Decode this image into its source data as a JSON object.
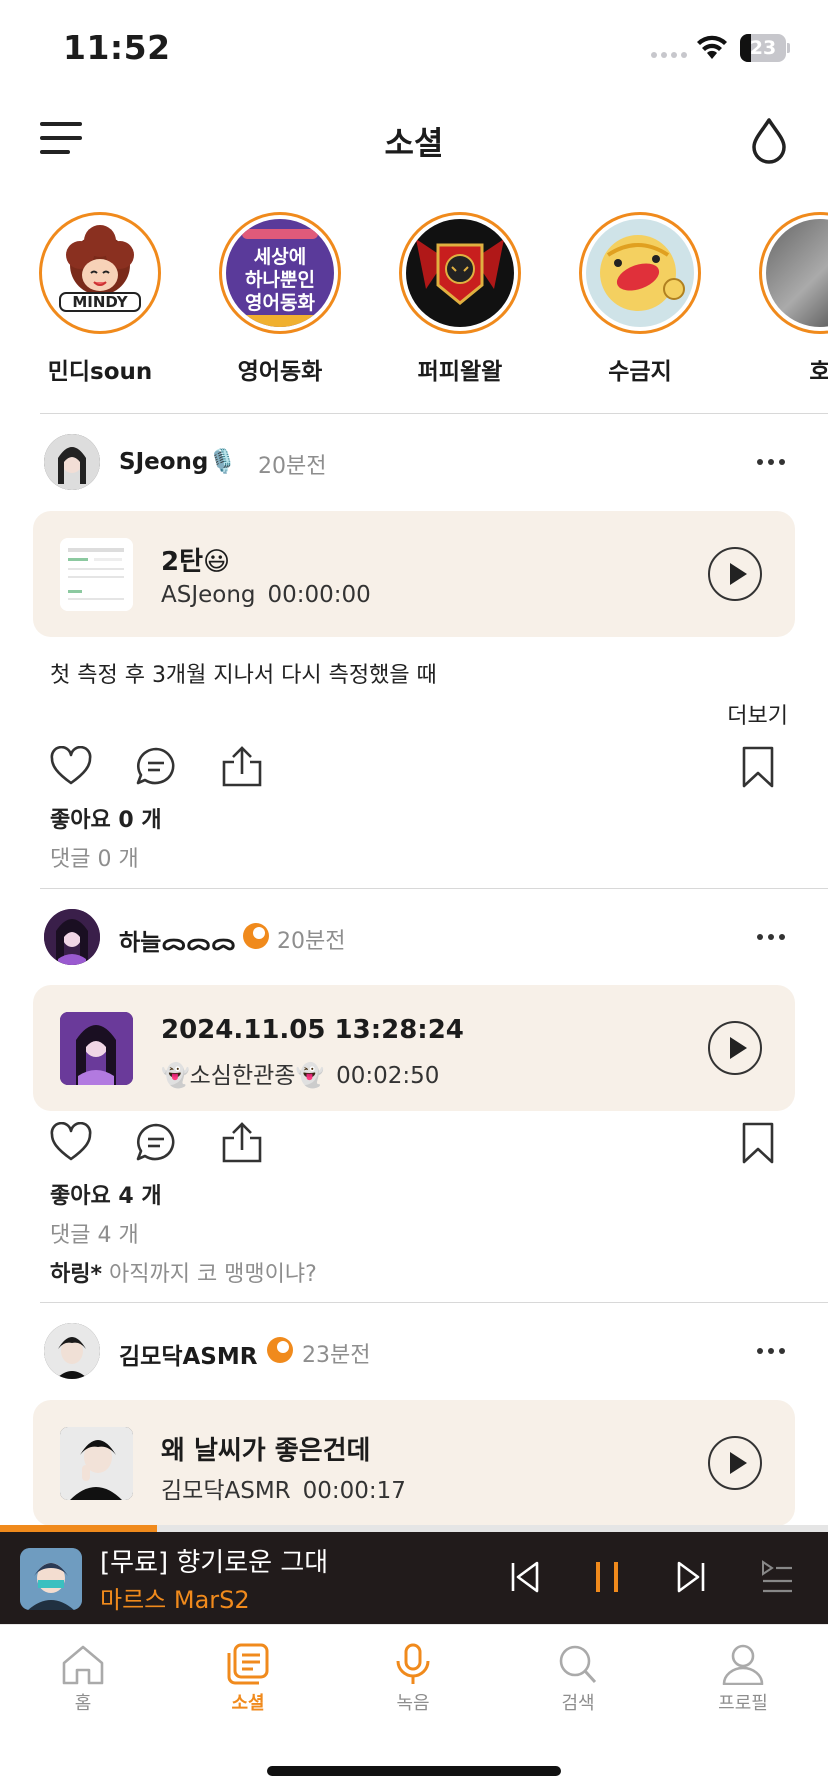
{
  "status_bar": {
    "time": "11:52",
    "battery": "23"
  },
  "header": {
    "title": "소셜",
    "menu_icon": "hamburger-menu-icon",
    "action_icon": "water-drop-icon"
  },
  "stories": [
    {
      "name": "민디soun"
    },
    {
      "name": "영어동화",
      "avatar_lines": [
        "세상에",
        "하나뿐인",
        "영어동화"
      ]
    },
    {
      "name": "퍼피왈왈"
    },
    {
      "name": "수금지"
    },
    {
      "name": "호"
    }
  ],
  "posts": [
    {
      "username": "SJeong🎙️",
      "time_ago": "20분전",
      "card": {
        "title": "2탄😃",
        "author": "ASJeong",
        "duration": "00:00:00"
      },
      "description": "첫 측정 후 3개월 지나서 다시 측정했을 때",
      "more_label": "더보기",
      "likes": "좋아요 0 개",
      "comments": "댓글 0 개"
    },
    {
      "username": "하늘ᯅᯅᯅ",
      "time_ago": "20분전",
      "card": {
        "title": "2024.11.05 13:28:24",
        "author": "👻소심한관종👻",
        "duration": "00:02:50"
      },
      "likes": "좋아요 4 개",
      "comments": "댓글 4 개",
      "comment_preview": {
        "user": "하링*",
        "text": "아직까지 코 맹맹이냐?"
      }
    },
    {
      "username": "김모닥ASMR",
      "time_ago": "23분전",
      "card": {
        "title": "왜 날씨가 좋은건데",
        "author": "김모닥ASMR",
        "duration": "00:00:17"
      }
    }
  ],
  "player": {
    "title": "[무료] 향기로운 그대",
    "artist": "마르스 MarS2",
    "progress": 0.19,
    "accent": "#f08a1c"
  },
  "tabs": [
    {
      "label": "홈",
      "icon": "home-icon"
    },
    {
      "label": "소셜",
      "icon": "social-feed-icon",
      "active": true
    },
    {
      "label": "녹음",
      "icon": "microphone-icon"
    },
    {
      "label": "검색",
      "icon": "search-icon"
    },
    {
      "label": "프로필",
      "icon": "profile-icon"
    }
  ],
  "colors": {
    "accent": "#f08a1c",
    "card_bg": "#f7f0e8",
    "player_bg": "#211b1b"
  }
}
